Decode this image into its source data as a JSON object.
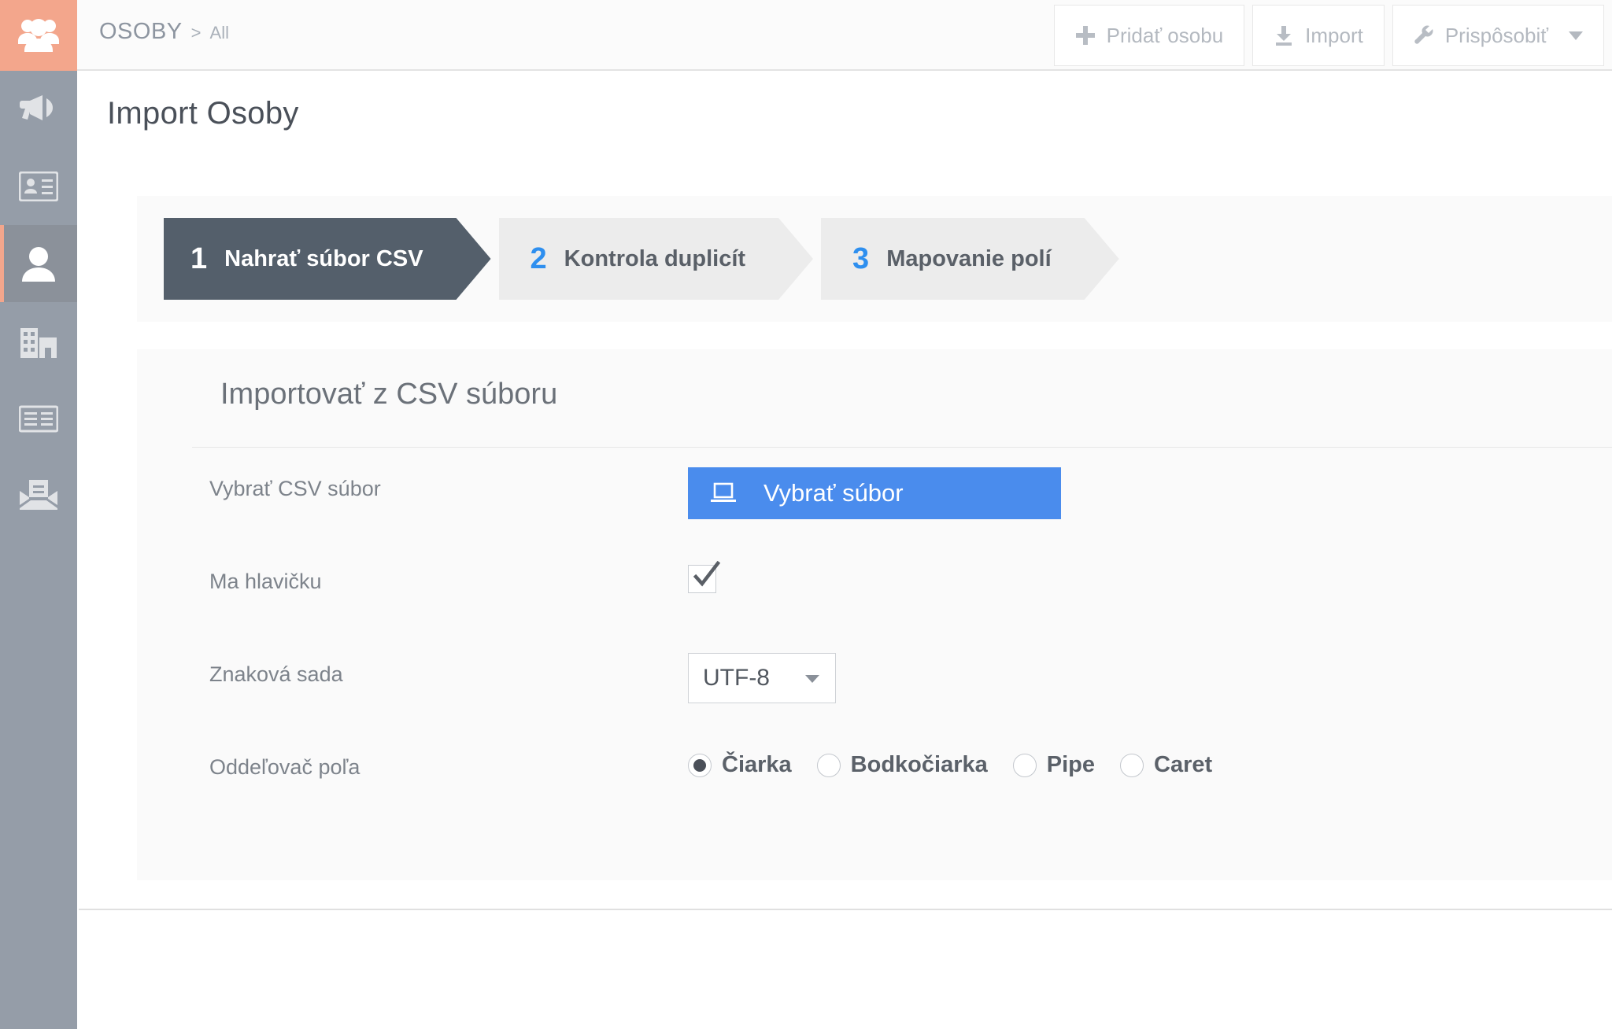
{
  "app": {
    "logo_icon": "group-people-icon",
    "accent_color": "#f3a68c",
    "sidebar_color": "#959da8"
  },
  "sidebar": {
    "items": [
      {
        "icon": "megaphone-icon",
        "active": false
      },
      {
        "icon": "contact-card-icon",
        "active": false
      },
      {
        "icon": "person-icon",
        "active": true
      },
      {
        "icon": "building-icon",
        "active": false
      },
      {
        "icon": "list-report-icon",
        "active": false
      },
      {
        "icon": "envelope-document-icon",
        "active": false
      }
    ]
  },
  "header": {
    "breadcrumb": {
      "root": "OSOBY",
      "separator": ">",
      "leaf": "All"
    },
    "buttons": [
      {
        "label": "Pridať osobu",
        "icon": "plus-icon",
        "caret": false
      },
      {
        "label": "Import",
        "icon": "download-icon",
        "caret": false
      },
      {
        "label": "Prispôsobiť",
        "icon": "wrench-icon",
        "caret": true
      }
    ]
  },
  "page": {
    "title": "Import Osoby"
  },
  "wizard": {
    "steps": [
      {
        "number": "1",
        "label": "Nahrať súbor CSV",
        "active": true
      },
      {
        "number": "2",
        "label": "Kontrola duplicít",
        "active": false
      },
      {
        "number": "3",
        "label": "Mapovanie polí",
        "active": false
      }
    ],
    "active_bg": "#545f6b",
    "inactive_bg": "#ececec",
    "number_color": "#2e8fef"
  },
  "form": {
    "title": "Importovať z CSV súboru",
    "file_row": {
      "label": "Vybrať CSV súbor",
      "button_label": "Vybrať súbor",
      "button_icon": "laptop-icon",
      "button_color": "#4a8ced"
    },
    "header_row": {
      "label": "Ma hlavičku",
      "checked": true
    },
    "charset_row": {
      "label": "Znaková sada",
      "value": "UTF-8",
      "options": [
        "UTF-8"
      ]
    },
    "delimiter_row": {
      "label": "Oddeľovač poľa",
      "options": [
        {
          "label": "Čiarka",
          "selected": true
        },
        {
          "label": "Bodkočiarka",
          "selected": false
        },
        {
          "label": "Pipe",
          "selected": false
        },
        {
          "label": "Caret",
          "selected": false
        }
      ]
    }
  }
}
